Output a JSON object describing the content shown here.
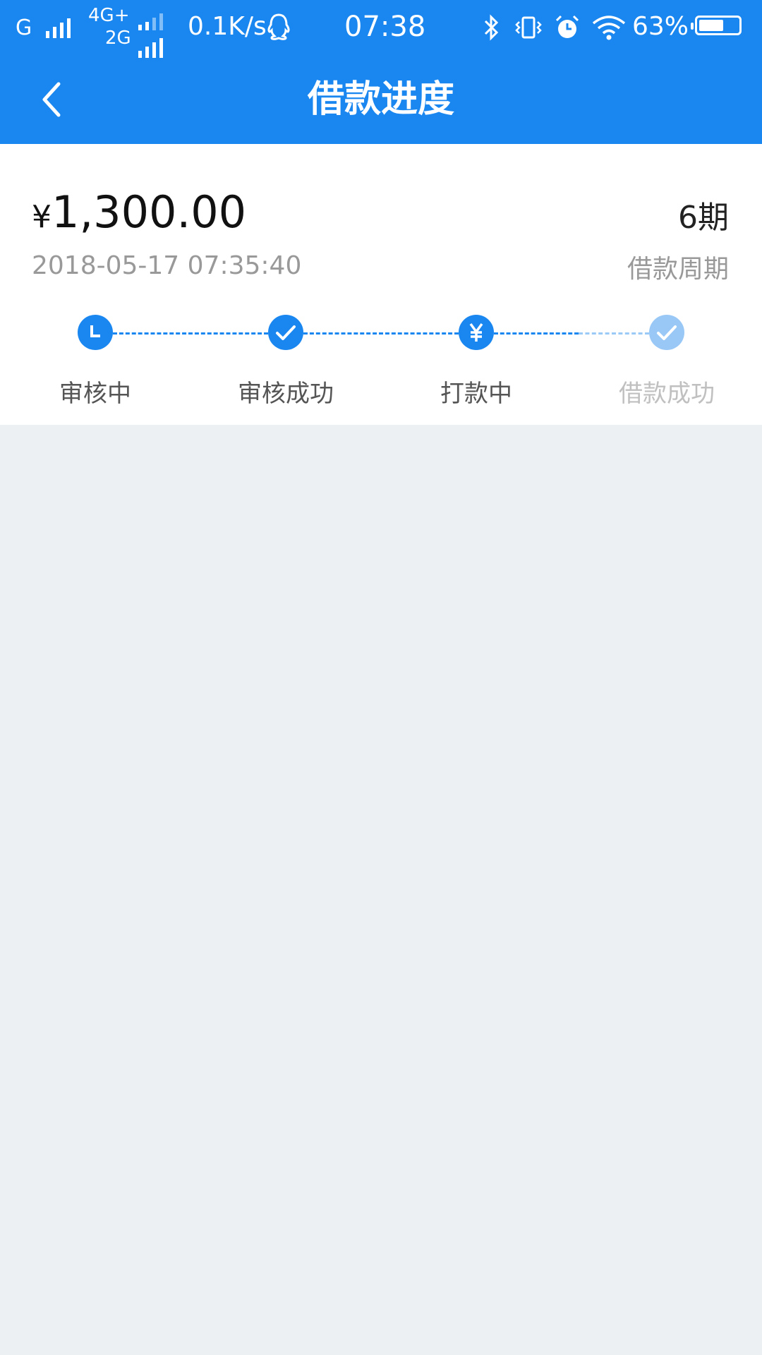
{
  "status_bar": {
    "carrier1": "G",
    "net_top": "4G+",
    "net_bottom": "2G",
    "speed": "0.1K/s",
    "time": "07:38",
    "battery": "63%",
    "battery_level": 0.63,
    "icons": [
      "qq-icon",
      "bluetooth-icon",
      "vibrate-icon",
      "alarm-icon",
      "wifi-icon",
      "battery-icon"
    ]
  },
  "header": {
    "title": "借款进度",
    "back_icon": "chevron-left-icon"
  },
  "loan": {
    "currency_symbol": "¥",
    "amount": "1,300.00",
    "datetime": "2018-05-17 07:35:40",
    "period_value": "6期",
    "period_label": "借款周期"
  },
  "steps": [
    {
      "label": "审核中",
      "icon": "clock-icon",
      "state": "done"
    },
    {
      "label": "审核成功",
      "icon": "check-icon",
      "state": "done"
    },
    {
      "label": "打款中",
      "icon": "yen-icon",
      "state": "current"
    },
    {
      "label": "借款成功",
      "icon": "check-icon",
      "state": "pending"
    }
  ],
  "colors": {
    "primary": "#1a87f0",
    "primary_faded": "#99c8f7",
    "background": "#ecf0f3",
    "card": "#ffffff"
  }
}
